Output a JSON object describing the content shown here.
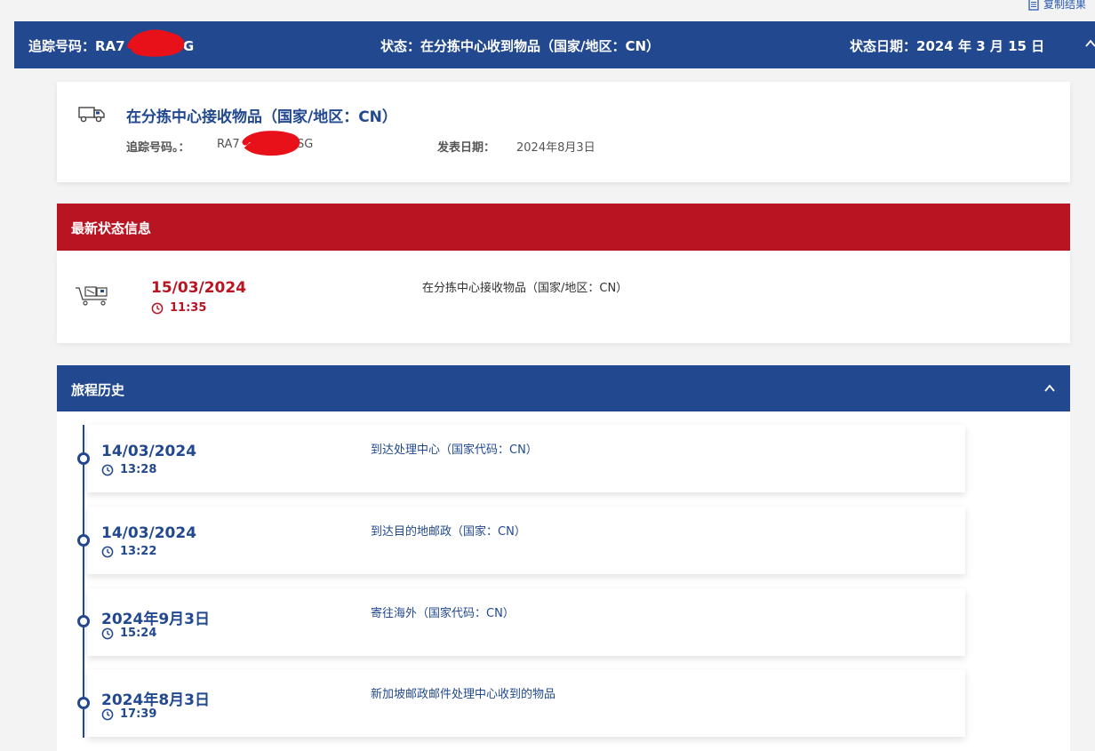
{
  "copy_link": {
    "label": "复制结果",
    "icon": "document-icon"
  },
  "top_bar": {
    "tracking": "追踪号码：RA7",
    "tracking_suffix": "4SG",
    "status": "状态：在分拣中心收到物品（国家/地区：CN）",
    "status_date": "状态日期：2024 年 3 月 15 日",
    "bg_color": "#22498f"
  },
  "summary": {
    "icon": "truck-icon",
    "title": "在分拣中心接收物品（国家/地区：CN）",
    "tracking_label": "追踪号码。：",
    "tracking_value_prefix": "RA7",
    "tracking_value_suffix": "4SG",
    "published_label": "发表日期：",
    "published_value": "2024年8月3日"
  },
  "latest": {
    "header": "最新状态信息",
    "header_color": "#b81422",
    "icon": "cart-icon",
    "date": "15/03/2024",
    "time": "11:35",
    "description": "在分拣中心接收物品（国家/地区：CN）"
  },
  "history": {
    "header": "旅程历史",
    "entries": [
      {
        "date": "14/03/2024",
        "time": "13:28",
        "description": "到达处理中心（国家代码：CN）"
      },
      {
        "date": "14/03/2024",
        "time": "13:22",
        "description": "到达目的地邮政（国家：CN）"
      },
      {
        "date": "2024年9月3日",
        "time": "15:24",
        "description": "寄往海外（国家代码：CN）"
      },
      {
        "date": "2024年8月3日",
        "time": "17:39",
        "description": "新加坡邮政邮件处理中心收到的物品"
      }
    ]
  }
}
